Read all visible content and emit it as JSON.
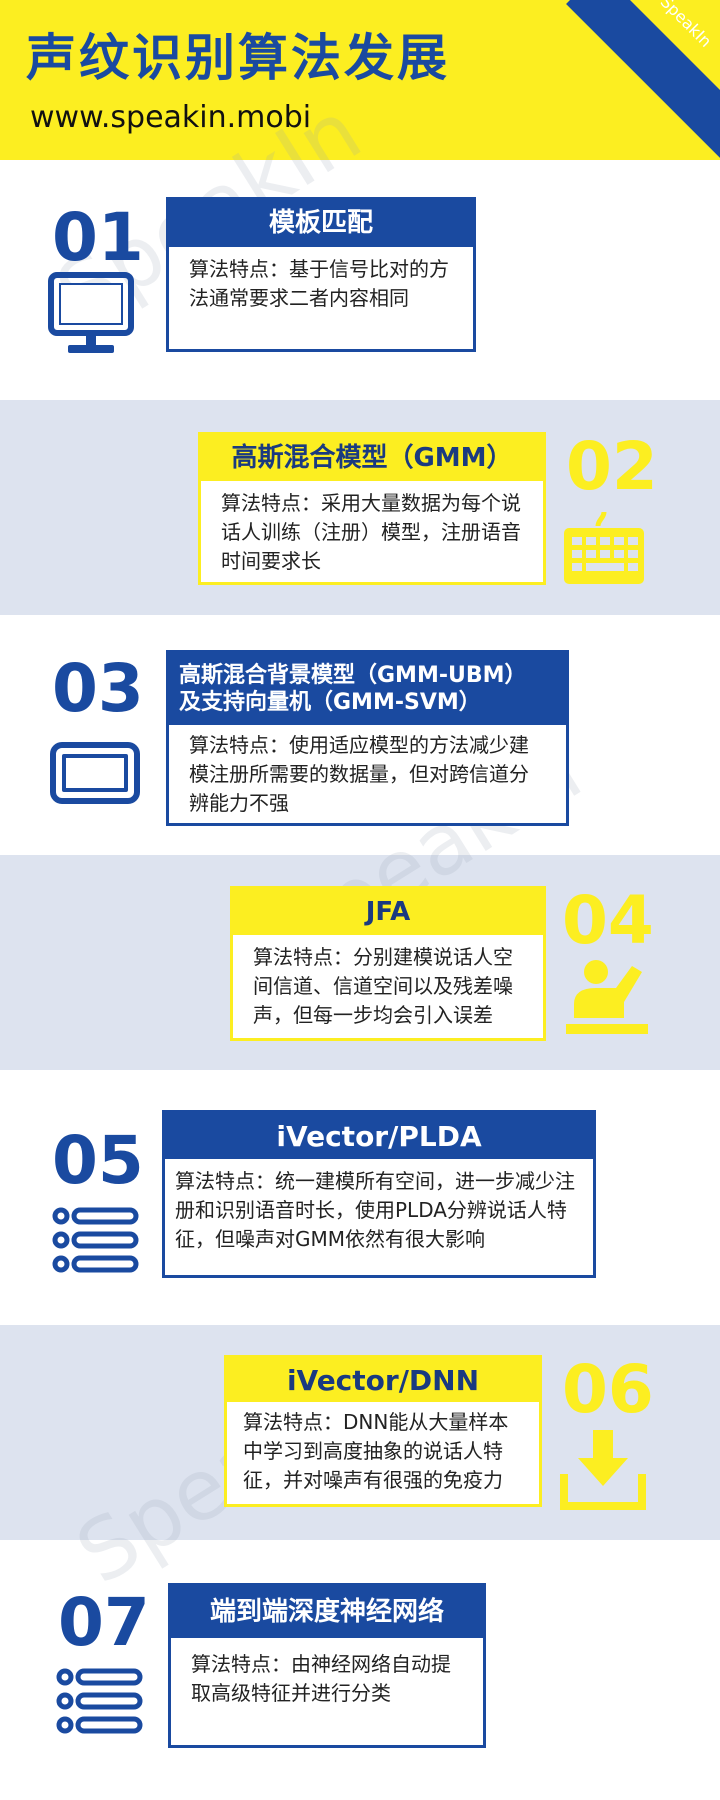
{
  "header": {
    "title": "声纹识别算法发展",
    "url": "www.speakin.mobi",
    "corner_label": "SpeakIn"
  },
  "watermark_text": "SpeakIn",
  "colors": {
    "blue": "#1a4aa0",
    "yellow": "#fcee21",
    "band": "#dde3ef"
  },
  "steps": [
    {
      "number": "01",
      "title": "模板匹配",
      "desc": "算法特点：基于信号比对的方法通常要求二者内容相同",
      "icon": "monitor-icon"
    },
    {
      "number": "02",
      "title": "高斯混合模型（GMM）",
      "desc": "算法特点：采用大量数据为每个说话人训练（注册）模型，注册语音时间要求长",
      "icon": "keyboard-icon"
    },
    {
      "number": "03",
      "title_line1": "高斯混合背景模型（GMM-UBM）",
      "title_line2": "及支持向量机（GMM-SVM）",
      "desc": "算法特点：使用适应模型的方法减少建模注册所需要的数据量，但对跨信道分辨能力不强",
      "icon": "tablet-icon"
    },
    {
      "number": "04",
      "title": "JFA",
      "desc": "算法特点：分别建模说话人空间信道、信道空间以及残差噪声，但每一步均会引入误差",
      "icon": "person-raise-hand-icon"
    },
    {
      "number": "05",
      "title": "iVector/PLDA",
      "desc": "算法特点：统一建模所有空间，进一步减少注册和识别语音时长，使用PLDA分辨说话人特征，但噪声对GMM依然有很大影响",
      "icon": "list-icon"
    },
    {
      "number": "06",
      "title": "iVector/DNN",
      "desc": "算法特点：DNN能从大量样本中学习到高度抽象的说话人特征，并对噪声有很强的免疫力",
      "icon": "download-icon"
    },
    {
      "number": "07",
      "title": "端到端深度神经网络",
      "desc": "算法特点：由神经网络自动提取高级特征并进行分类",
      "icon": "list-icon"
    }
  ]
}
